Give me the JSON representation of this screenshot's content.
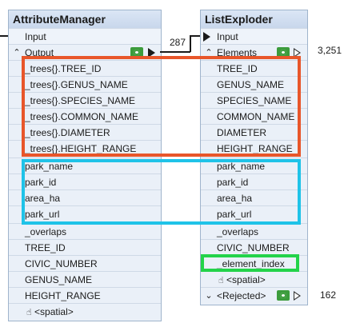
{
  "attribute_manager": {
    "title": "AttributeManager",
    "input_label": "Input",
    "output_label": "Output",
    "attributes": [
      "_trees{}.TREE_ID",
      "_trees{}.GENUS_NAME",
      "_trees{}.SPECIES_NAME",
      "_trees{}.COMMON_NAME",
      "_trees{}.DIAMETER",
      "_trees{}.HEIGHT_RANGE",
      "park_name",
      "park_id",
      "area_ha",
      "park_url",
      "_overlaps",
      "TREE_ID",
      "CIVIC_NUMBER",
      "GENUS_NAME",
      "HEIGHT_RANGE",
      "<spatial>"
    ]
  },
  "list_exploder": {
    "title": "ListExploder",
    "input_label": "Input",
    "elements_label": "Elements",
    "elements_count": "3,251",
    "attributes": [
      "TREE_ID",
      "GENUS_NAME",
      "SPECIES_NAME",
      "COMMON_NAME",
      "DIAMETER",
      "HEIGHT_RANGE",
      "park_name",
      "park_id",
      "area_ha",
      "park_url",
      "_overlaps",
      "CIVIC_NUMBER",
      "_element_index",
      "<spatial>"
    ],
    "rejected_label": "<Rejected>",
    "rejected_count": "162"
  },
  "connection": {
    "count": "287"
  },
  "colors": {
    "orange_highlight": "#e8562a",
    "cyan_highlight": "#1fc3e8",
    "green_highlight": "#23d34a",
    "eye_green": "#3c9c3c"
  },
  "icons": {
    "chevron_up": "chevron-up-icon",
    "chevron_down": "chevron-down-icon",
    "eye": "eye-icon",
    "play": "play-icon",
    "spatial": "spatial-icon"
  }
}
